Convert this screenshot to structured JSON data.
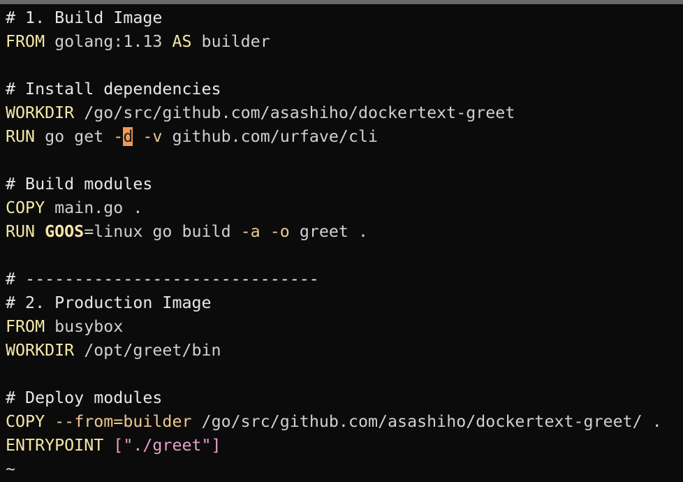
{
  "editor": {
    "lines": [
      [
        {
          "t": "comment",
          "v": "# 1. Build Image"
        }
      ],
      [
        {
          "t": "kw",
          "v": "FROM"
        },
        {
          "t": "plain",
          "v": " golang:1.13 "
        },
        {
          "t": "kw",
          "v": "AS"
        },
        {
          "t": "plain",
          "v": " builder"
        }
      ],
      [],
      [
        {
          "t": "comment",
          "v": "# Install dependencies"
        }
      ],
      [
        {
          "t": "kw",
          "v": "WORKDIR"
        },
        {
          "t": "plain",
          "v": " /go/src/github.com/asashiho/dockertext-greet"
        }
      ],
      [
        {
          "t": "kw",
          "v": "RUN"
        },
        {
          "t": "plain",
          "v": " go get "
        },
        {
          "t": "flag",
          "v": "-"
        },
        {
          "t": "cursor",
          "v": "d"
        },
        {
          "t": "plain",
          "v": " "
        },
        {
          "t": "flag",
          "v": "-v"
        },
        {
          "t": "plain",
          "v": " github.com/urfave/cli"
        }
      ],
      [],
      [
        {
          "t": "comment",
          "v": "# Build modules"
        }
      ],
      [
        {
          "t": "kw",
          "v": "COPY"
        },
        {
          "t": "plain",
          "v": " main.go ."
        }
      ],
      [
        {
          "t": "kw",
          "v": "RUN"
        },
        {
          "t": "plain",
          "v": " "
        },
        {
          "t": "kw-bold",
          "v": "GOOS"
        },
        {
          "t": "plain",
          "v": "=linux go build "
        },
        {
          "t": "flag",
          "v": "-a"
        },
        {
          "t": "plain",
          "v": " "
        },
        {
          "t": "flag",
          "v": "-o"
        },
        {
          "t": "plain",
          "v": " greet ."
        }
      ],
      [],
      [
        {
          "t": "comment",
          "v": "# ------------------------------"
        }
      ],
      [
        {
          "t": "comment",
          "v": "# 2. Production Image"
        }
      ],
      [
        {
          "t": "kw",
          "v": "FROM"
        },
        {
          "t": "plain",
          "v": " busybox"
        }
      ],
      [
        {
          "t": "kw",
          "v": "WORKDIR"
        },
        {
          "t": "plain",
          "v": " /opt/greet/bin"
        }
      ],
      [],
      [
        {
          "t": "comment",
          "v": "# Deploy modules"
        }
      ],
      [
        {
          "t": "kw",
          "v": "COPY"
        },
        {
          "t": "plain",
          "v": " "
        },
        {
          "t": "flag",
          "v": "--from=builder"
        },
        {
          "t": "plain",
          "v": " /go/src/github.com/asashiho/dockertext-greet/ ."
        }
      ],
      [
        {
          "t": "kw",
          "v": "ENTRYPOINT"
        },
        {
          "t": "plain",
          "v": " "
        },
        {
          "t": "str",
          "v": "[\"./greet\"]"
        }
      ],
      [
        {
          "t": "tilde",
          "v": "~"
        }
      ]
    ]
  }
}
